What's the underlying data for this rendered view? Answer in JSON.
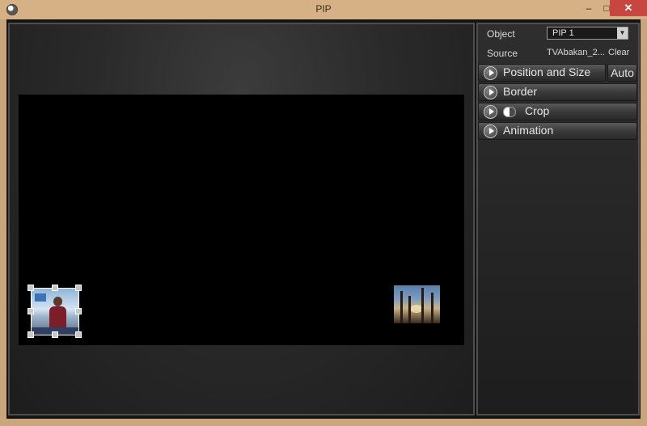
{
  "window": {
    "title": "PIP",
    "minimize_glyph": "–",
    "maximize_glyph": "□",
    "close_glyph": "✕"
  },
  "properties": {
    "object_label": "Object",
    "object_value": "PIP 1",
    "source_label": "Source",
    "source_value": "TVAbakan_2...",
    "clear_label": "Clear"
  },
  "sections": {
    "position_size": "Position and Size",
    "auto": "Auto",
    "border": "Border",
    "crop": "Crop",
    "animation": "Animation"
  },
  "icons": {
    "app": "app-logo-icon",
    "section_expand": "play-circle-icon",
    "crop_toggle": "toggle-icon",
    "dropdown": "chevron-down-icon"
  },
  "colors": {
    "accent_title_bar": "#d6b185",
    "close_button": "#c7463f",
    "panel_bg": "#2a2a2a"
  }
}
